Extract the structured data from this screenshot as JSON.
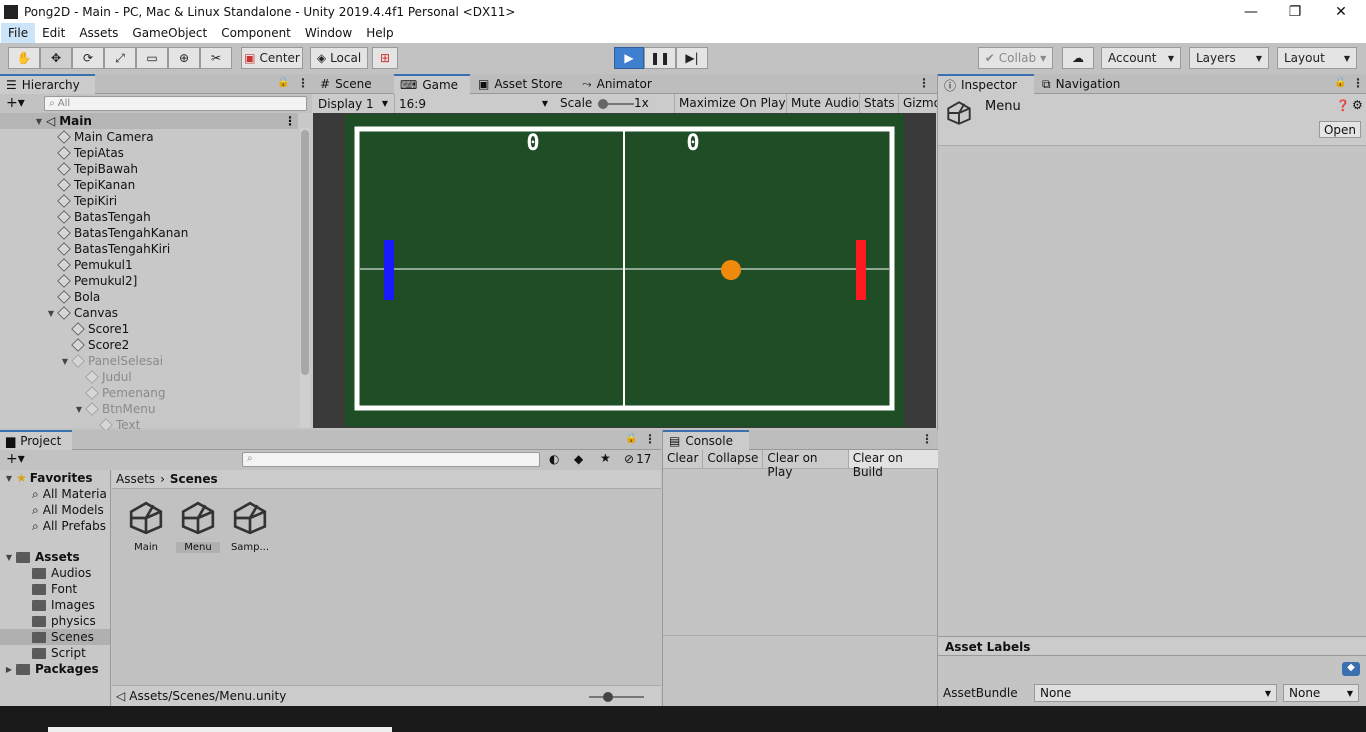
{
  "window": {
    "title": "Pong2D - Main - PC, Mac & Linux Standalone - Unity 2019.4.4f1 Personal <DX11>",
    "minimize": "—",
    "maximize": "❐",
    "close": "✕"
  },
  "menu": [
    "File",
    "Edit",
    "Assets",
    "GameObject",
    "Component",
    "Window",
    "Help"
  ],
  "toolbar": {
    "center_label": "Center",
    "local_label": "Local",
    "collab_label": "Collab",
    "account_label": "Account",
    "layers_label": "Layers",
    "layout_label": "Layout"
  },
  "hierarchy": {
    "tab": "Hierarchy",
    "search_placeholder": "All",
    "scene": "Main",
    "items": [
      {
        "label": "Main Camera",
        "dim": false
      },
      {
        "label": "TepiAtas",
        "dim": false
      },
      {
        "label": "TepiBawah",
        "dim": false
      },
      {
        "label": "TepiKanan",
        "dim": false
      },
      {
        "label": "TepiKiri",
        "dim": false
      },
      {
        "label": "BatasTengah",
        "dim": false
      },
      {
        "label": "BatasTengahKanan",
        "dim": false
      },
      {
        "label": "BatasTengahKiri",
        "dim": false
      },
      {
        "label": "Pemukul1",
        "dim": false
      },
      {
        "label": "Pemukul2]",
        "dim": false
      },
      {
        "label": "Bola",
        "dim": false
      },
      {
        "label": "Canvas",
        "dim": false
      },
      {
        "label": "Score1",
        "dim": false
      },
      {
        "label": "Score2",
        "dim": false
      },
      {
        "label": "PanelSelesai",
        "dim": true
      },
      {
        "label": "Judul",
        "dim": true
      },
      {
        "label": "Pemenang",
        "dim": true
      },
      {
        "label": "BtnMenu",
        "dim": true
      },
      {
        "label": "Text",
        "dim": true
      }
    ]
  },
  "game_view": {
    "tabs": [
      "Scene",
      "Game",
      "Asset Store",
      "Animator"
    ],
    "display": "Display 1",
    "aspect": "16:9",
    "scale_label": "Scale",
    "scale_value": "1x",
    "maximize": "Maximize On Play",
    "mute": "Mute Audio",
    "stats": "Stats",
    "gizmos": "Gizmo",
    "score_left": "0",
    "score_right": "0",
    "colors": {
      "field": "#1f4d26",
      "paddle_left": "#1a1aff",
      "paddle_right": "#ff1a22",
      "ball": "#f08a0c"
    }
  },
  "inspector": {
    "tabs": [
      "Inspector",
      "Navigation"
    ],
    "asset_name": "Menu",
    "open_label": "Open",
    "asset_labels": "Asset Labels",
    "assetbundle_label": "AssetBundle",
    "bundle_value": "None",
    "variant_value": "None"
  },
  "project": {
    "tab": "Project",
    "favorites_label": "Favorites",
    "favorites": [
      "All Materia",
      "All Models",
      "All Prefabs"
    ],
    "assets_label": "Assets",
    "folders": [
      "Audios",
      "Font",
      "Images",
      "physics",
      "Scenes",
      "Script"
    ],
    "packages_label": "Packages",
    "breadcrumb_root": "Assets",
    "breadcrumb_current": "Scenes",
    "files": [
      "Main",
      "Menu",
      "Samp..."
    ],
    "path": "Assets/Scenes/Menu.unity",
    "hidden_count": "17"
  },
  "console": {
    "tab": "Console",
    "clear": "Clear",
    "collapse": "Collapse",
    "clear_on_play": "Clear on Play",
    "clear_on_build": "Clear on Build"
  }
}
